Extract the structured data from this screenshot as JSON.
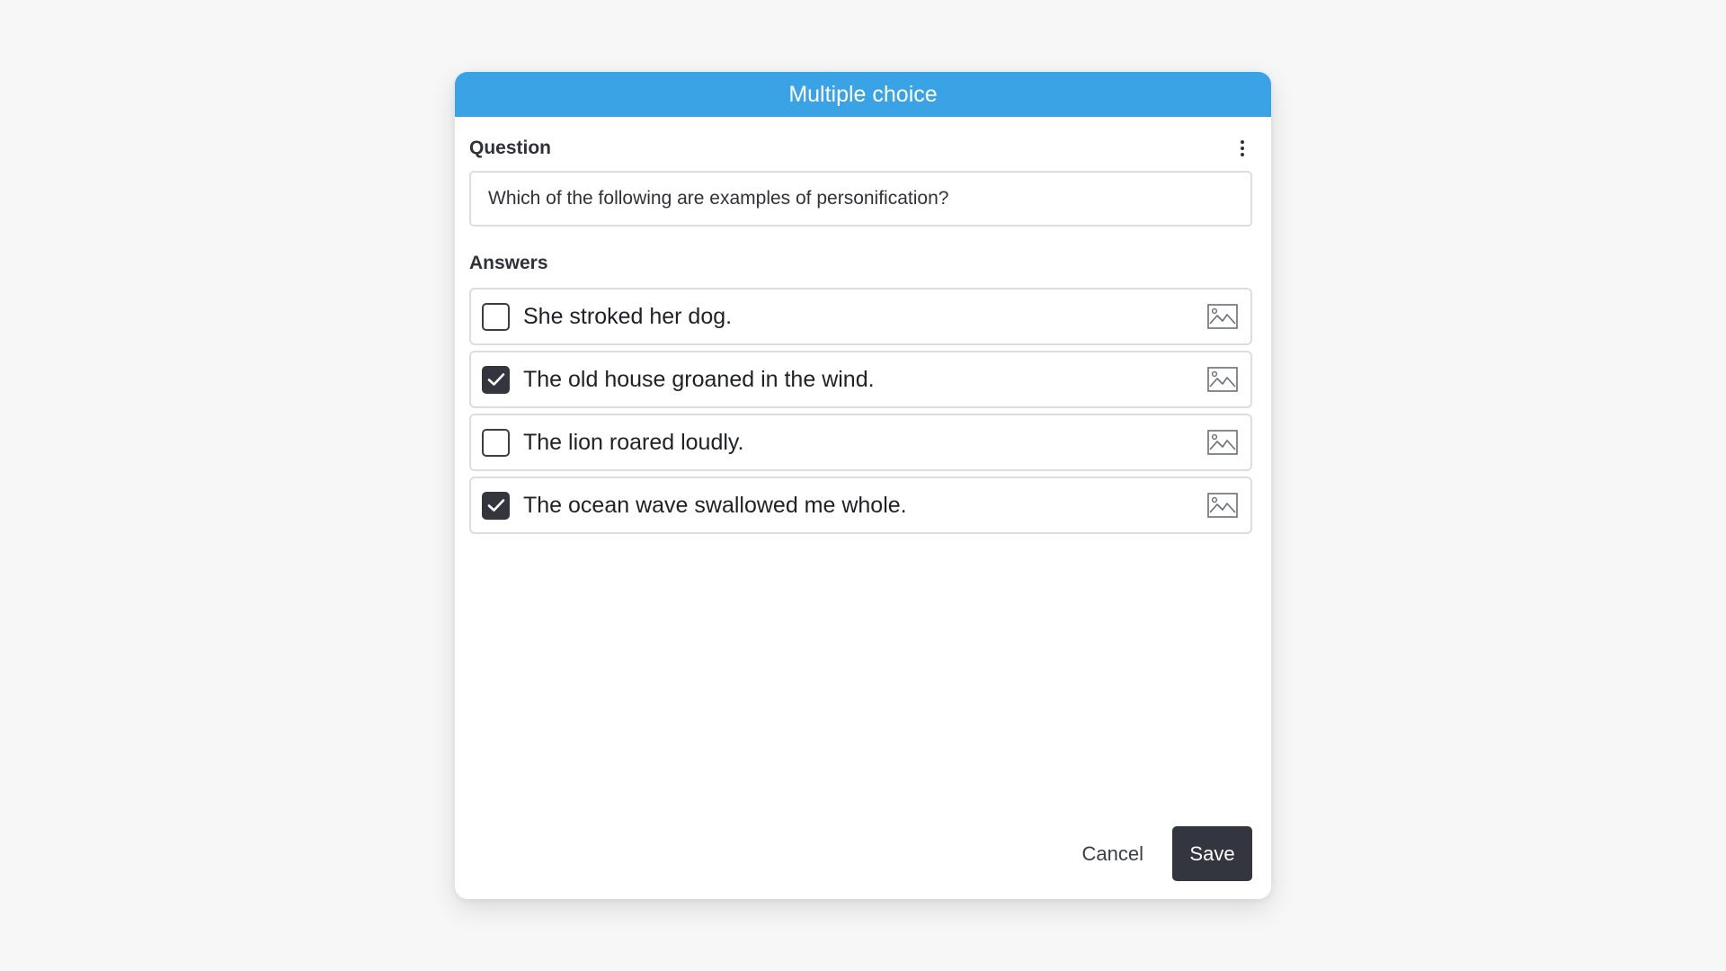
{
  "dialog": {
    "title": "Multiple choice"
  },
  "question": {
    "label": "Question",
    "value": "Which of the following are examples of personification?",
    "menu_icon": "more-vertical-icon"
  },
  "answers": {
    "label": "Answers",
    "items": [
      {
        "text": "She stroked her dog.",
        "checked": false,
        "image_icon": "image-icon"
      },
      {
        "text": "The old house groaned in the wind.",
        "checked": true,
        "image_icon": "image-icon"
      },
      {
        "text": "The lion roared loudly.",
        "checked": false,
        "image_icon": "image-icon"
      },
      {
        "text": "The ocean wave swallowed me whole.",
        "checked": true,
        "image_icon": "image-icon"
      }
    ]
  },
  "footer": {
    "cancel_label": "Cancel",
    "save_label": "Save"
  },
  "colors": {
    "header": "#3aa3e6",
    "primary_button": "#33363f",
    "border": "#dcdde0"
  }
}
